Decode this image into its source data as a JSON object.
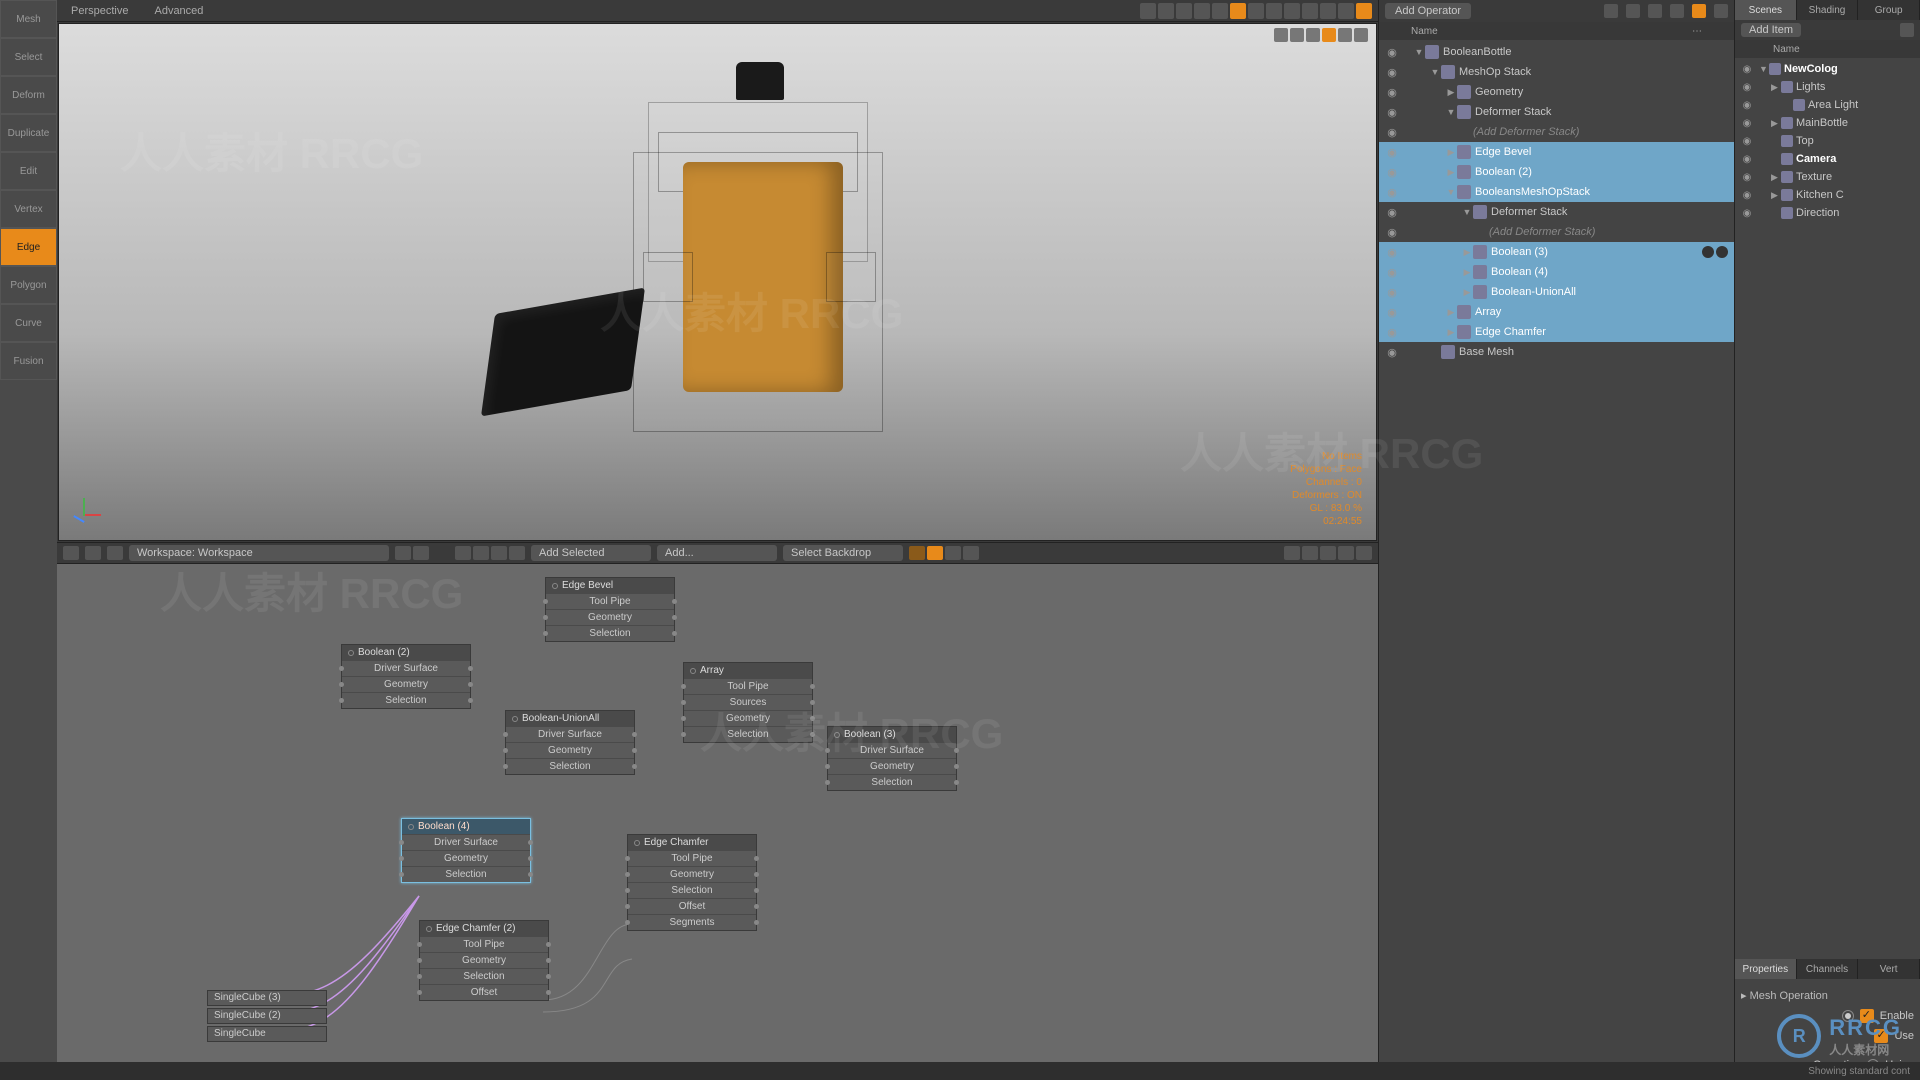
{
  "viewport": {
    "mode_a": "Perspective",
    "mode_b": "Advanced",
    "info": {
      "l1": "No Items",
      "l2": "Polygons : Face",
      "l3": "Channels : 0",
      "l4": "Deformers : ON",
      "l5": "GL : 83.0 %",
      "l6": "02:24:55"
    }
  },
  "leftTools": [
    "Mesh",
    "Select",
    "Deform",
    "Duplicate",
    "Edit",
    "Vertex",
    "Edge",
    "Polygon",
    "Curve",
    "Fusion"
  ],
  "activeTool": "Edge",
  "nodeBar": {
    "workspace": "Workspace: Workspace",
    "addSelected": "Add Selected",
    "add": "Add...",
    "selectBackdrop": "Select Backdrop"
  },
  "nodes": {
    "edgeBevel": {
      "title": "Edge Bevel",
      "rows": [
        "Tool Pipe",
        "Geometry",
        "Selection"
      ]
    },
    "boolean2": {
      "title": "Boolean (2)",
      "rows": [
        "Driver Surface",
        "Geometry",
        "Selection"
      ]
    },
    "unionAll": {
      "title": "Boolean-UnionAll",
      "rows": [
        "Driver Surface",
        "Geometry",
        "Selection"
      ]
    },
    "array": {
      "title": "Array",
      "rows": [
        "Tool Pipe",
        "Sources",
        "Geometry",
        "Selection"
      ]
    },
    "boolean3": {
      "title": "Boolean (3)",
      "rows": [
        "Driver Surface",
        "Geometry",
        "Selection"
      ]
    },
    "boolean4": {
      "title": "Boolean (4)",
      "rows": [
        "Driver Surface",
        "Geometry",
        "Selection"
      ]
    },
    "edgeChamfer": {
      "title": "Edge Chamfer",
      "rows": [
        "Tool Pipe",
        "Geometry",
        "Selection",
        "Offset",
        "Segments"
      ]
    },
    "edgeChamfer2": {
      "title": "Edge Chamfer (2)",
      "rows": [
        "Tool Pipe",
        "Geometry",
        "Selection",
        "Offset"
      ]
    },
    "cubes": [
      "SingleCube (3)",
      "SingleCube (2)",
      "SingleCube"
    ]
  },
  "operator": {
    "dropdown": "Add Operator",
    "col1": "Name",
    "tree": [
      {
        "d": 0,
        "arrow": "▼",
        "label": "BooleanBottle",
        "sel": false
      },
      {
        "d": 1,
        "arrow": "▼",
        "label": "MeshOp Stack",
        "sel": false
      },
      {
        "d": 2,
        "arrow": "▶",
        "label": "Geometry",
        "sel": false
      },
      {
        "d": 2,
        "arrow": "▼",
        "label": "Deformer Stack",
        "sel": false
      },
      {
        "d": 3,
        "arrow": "",
        "label": "(Add Deformer Stack)",
        "sel": false,
        "hint": true
      },
      {
        "d": 2,
        "arrow": "▶",
        "label": "Edge Bevel",
        "sel": true
      },
      {
        "d": 2,
        "arrow": "▶",
        "label": "Boolean (2)",
        "sel": true
      },
      {
        "d": 2,
        "arrow": "▼",
        "label": "BooleansMeshOpStack",
        "sel": true
      },
      {
        "d": 3,
        "arrow": "▼",
        "label": "Deformer Stack",
        "sel": false
      },
      {
        "d": 4,
        "arrow": "",
        "label": "(Add Deformer Stack)",
        "sel": false,
        "hint": true
      },
      {
        "d": 3,
        "arrow": "▶",
        "label": "Boolean (3)",
        "sel": true,
        "badges": true
      },
      {
        "d": 3,
        "arrow": "▶",
        "label": "Boolean (4)",
        "sel": true,
        "bold": true
      },
      {
        "d": 3,
        "arrow": "▶",
        "label": "Boolean-UnionAll",
        "sel": true
      },
      {
        "d": 2,
        "arrow": "▶",
        "label": "Array",
        "sel": true
      },
      {
        "d": 2,
        "arrow": "▶",
        "label": "Edge Chamfer",
        "sel": true
      },
      {
        "d": 1,
        "arrow": "",
        "label": "Base Mesh",
        "sel": false
      }
    ]
  },
  "scenes": {
    "tabs": [
      "Scenes",
      "Shading",
      "Group"
    ],
    "activeTab": "Scenes",
    "addItem": "Add Item",
    "colName": "Name",
    "tree": [
      {
        "d": 0,
        "arrow": "▼",
        "label": "NewColog",
        "bold": true
      },
      {
        "d": 1,
        "arrow": "▶",
        "label": "Lights"
      },
      {
        "d": 2,
        "arrow": "",
        "label": "Area Light"
      },
      {
        "d": 1,
        "arrow": "▶",
        "label": "MainBottle"
      },
      {
        "d": 1,
        "arrow": "",
        "label": "Top"
      },
      {
        "d": 1,
        "arrow": "",
        "label": "Camera",
        "bold": true
      },
      {
        "d": 1,
        "arrow": "▶",
        "label": "Texture"
      },
      {
        "d": 1,
        "arrow": "▶",
        "label": "Kitchen C"
      },
      {
        "d": 1,
        "arrow": "",
        "label": "Direction"
      }
    ]
  },
  "props": {
    "tabs": [
      "Properties",
      "Channels",
      "Vert"
    ],
    "activeTab": "Properties",
    "section": "Mesh Operation",
    "enable": "Enable",
    "use": "Use",
    "operationLabel": "Operation",
    "operationValue": "Union"
  },
  "status": "Showing standard cont",
  "watermark": "人人素材   RRCG"
}
